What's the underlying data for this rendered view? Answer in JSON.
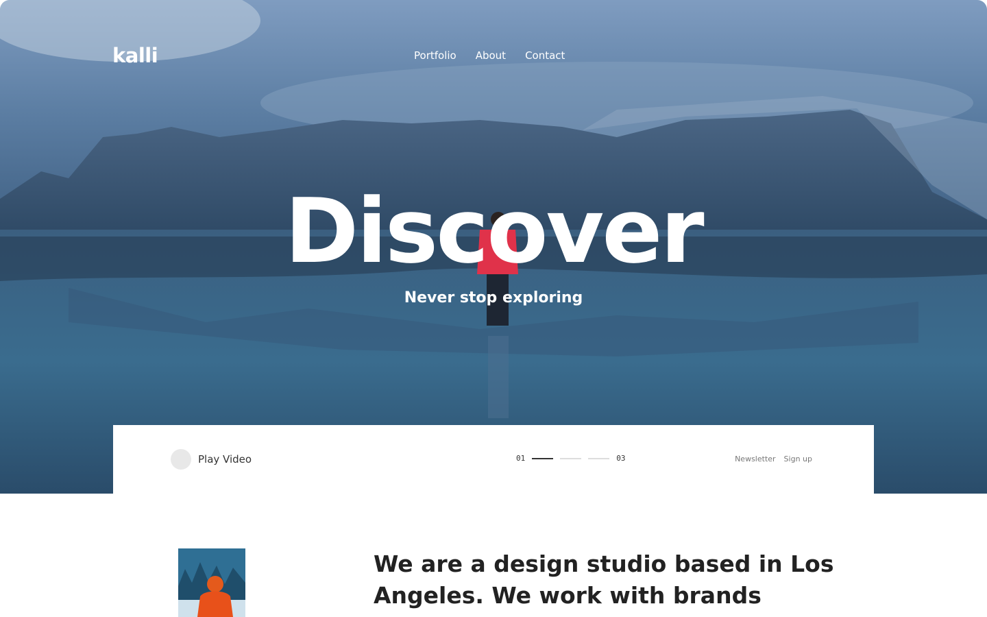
{
  "brand": {
    "logo": "kalli"
  },
  "nav": {
    "items": [
      "Portfolio",
      "About",
      "Contact"
    ]
  },
  "hero": {
    "title": "Discover",
    "subtitle": "Never stop exploring"
  },
  "bar": {
    "play_label": "Play Video",
    "pager": {
      "start": "01",
      "end": "03",
      "current_index": 1,
      "total": 3
    },
    "newsletter_label": "Newsletter",
    "signup_label": "Sign up"
  },
  "about": {
    "headline": "We are a design studio based in Los Angeles. We work with brands"
  },
  "colors": {
    "text_dark": "#222222",
    "hero_sky": "#6f8fb3",
    "hero_water": "#2f5877",
    "jacket": "#e0324a"
  }
}
